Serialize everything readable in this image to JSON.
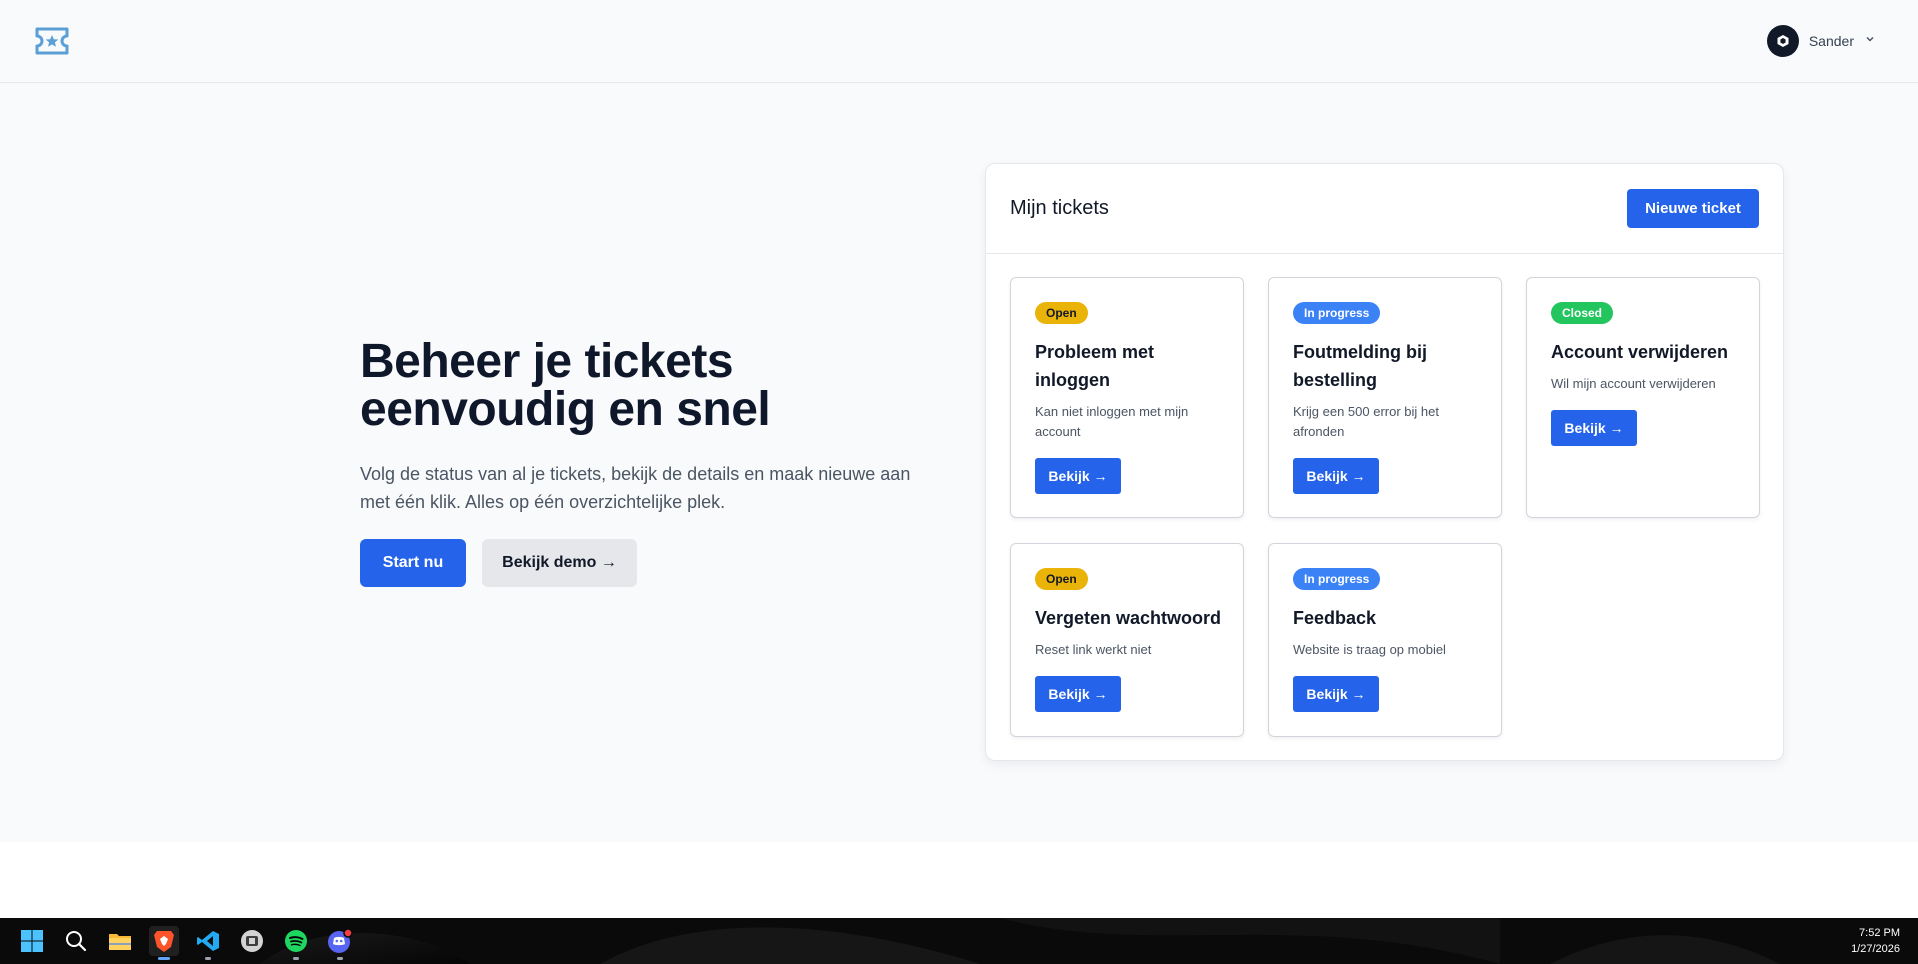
{
  "header": {
    "logo_icon": "ticket-star-icon",
    "user_name": "Sander",
    "avatar_icon": "avatar-logo-icon",
    "dropdown_icon": "chevron-down-icon"
  },
  "hero": {
    "title_line1": "Beheer je tickets",
    "title_line2": "eenvoudig en snel",
    "description": "Volg de status van al je tickets, bekijk de details en maak nieuwe aan met één klik. Alles op één overzichtelijke plek.",
    "primary_button": "Start nu",
    "secondary_button": "Bekijk demo →"
  },
  "tickets_panel": {
    "title": "Mijn tickets",
    "new_button": "Nieuwe ticket",
    "tickets": [
      {
        "status": "Open",
        "title": "Probleem met inloggen",
        "description": "Kan niet inloggen met mijn account",
        "button": "Bekijk →"
      },
      {
        "status": "In progress",
        "title": "Foutmelding bij bestelling",
        "description": "Krijg een 500 error bij het afronden",
        "button": "Bekijk →"
      },
      {
        "status": "Closed",
        "title": "Account verwijderen",
        "description": "Wil mijn account verwijderen",
        "button": "Bekijk →"
      },
      {
        "status": "Open",
        "title": "Vergeten wachtwoord",
        "description": "Reset link werkt niet",
        "button": "Bekijk →"
      },
      {
        "status": "In progress",
        "title": "Feedback",
        "description": "Website is traag op mobiel",
        "button": "Bekijk →"
      }
    ]
  },
  "colors": {
    "primary": "#2563eb",
    "status_open": "#eab308",
    "status_in_progress": "#3b82f6",
    "status_closed": "#22c55e"
  },
  "taskbar": {
    "icons": [
      "windows-start-icon",
      "search-icon",
      "file-explorer-icon",
      "brave-browser-icon",
      "vscode-icon",
      "app-icon",
      "spotify-icon",
      "discord-icon"
    ],
    "time": "7:52 PM",
    "date": "1/27/2026"
  }
}
